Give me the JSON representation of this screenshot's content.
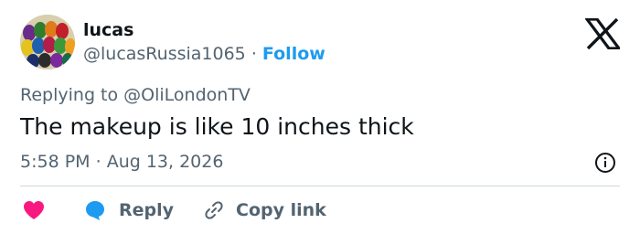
{
  "author": {
    "name": "lucas",
    "handle": "@lucasRussia1065",
    "separator": "·",
    "follow_label": "Follow"
  },
  "reply_context": {
    "prefix": "Replying to ",
    "target": "@OliLondonTV"
  },
  "tweet": {
    "text": "The makeup is like 10 inches thick",
    "time": "5:58 PM",
    "separator": "·",
    "date": "Aug 13, 2026"
  },
  "actions": {
    "reply_label": "Reply",
    "copy_link_label": "Copy link"
  },
  "icons": {
    "brand": "x-logo-icon",
    "info": "info-icon",
    "like": "heart-icon",
    "reply": "speech-bubble-icon",
    "copy": "link-icon"
  },
  "colors": {
    "accent": "#1d9bf0",
    "heart": "#f91880",
    "secondary_text": "#536471",
    "primary_text": "#0f1419",
    "divider": "#cfd9de"
  }
}
